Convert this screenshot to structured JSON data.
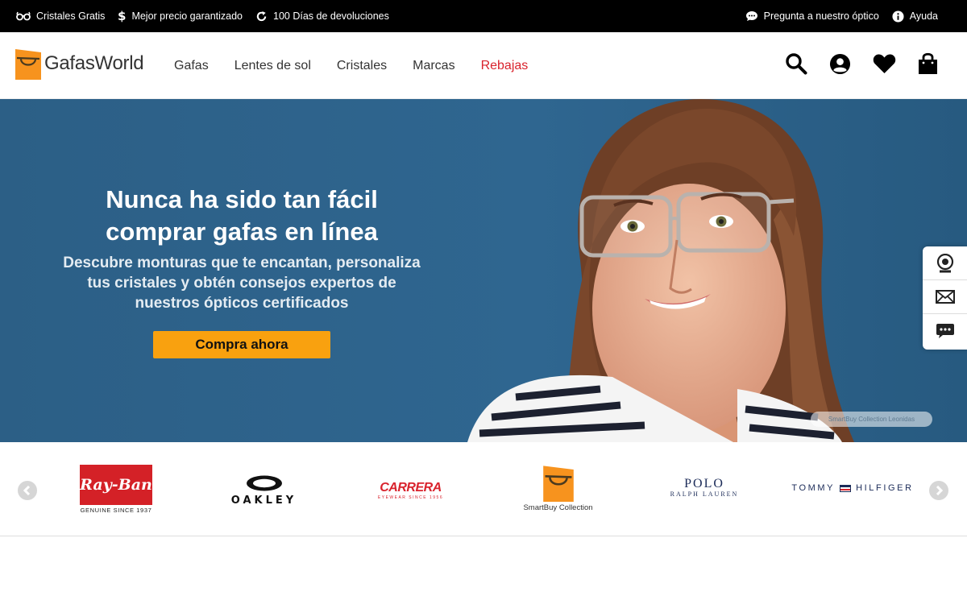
{
  "topbar": {
    "left": [
      {
        "icon": "glasses-icon",
        "label": "Cristales Gratis"
      },
      {
        "icon": "dollar-icon",
        "label": "Mejor precio garantizado"
      },
      {
        "icon": "refresh-icon",
        "label": "100 Días de devoluciones"
      }
    ],
    "right": [
      {
        "icon": "chat-bubble-icon",
        "label": "Pregunta a nuestro óptico"
      },
      {
        "icon": "info-icon",
        "label": "Ayuda"
      }
    ]
  },
  "header": {
    "logo_text": "GafasWorld",
    "nav": [
      "Gafas",
      "Lentes de sol",
      "Cristales",
      "Marcas",
      "Rebajas"
    ],
    "icons": [
      "search-icon",
      "account-icon",
      "heart-icon",
      "shopping-bag-icon"
    ]
  },
  "hero": {
    "title_line1": "Nunca ha sido tan fácil",
    "title_line2": "comprar gafas en línea",
    "subtitle_line1": "Descubre monturas que te encantan, personaliza",
    "subtitle_line2": "tus cristales y obtén consejos expertos de",
    "subtitle_line3": "nuestros ópticos certificados",
    "cta": "Compra ahora",
    "caption": "SmartBuy Collection Leonidas"
  },
  "side_widget": [
    "webcam-icon",
    "mail-icon",
    "chat-icon"
  ],
  "brands": {
    "rayban_name": "Ray-Ban",
    "rayban_tag": "GENUINE SINCE 1937",
    "oakley": "OAKLEY",
    "carrera_name": "CARRERA",
    "carrera_tag": "EYEWEAR SINCE 1956",
    "smartbuy": "SmartBuy Collection",
    "polo_line1": "POLO",
    "polo_line2": "RALPH LAUREN",
    "tommy_left": "TOMMY",
    "tommy_right": "HILFIGER"
  },
  "colors": {
    "accent": "#f9a10f",
    "sale": "#d9232d",
    "hero_bg": "#2f6690"
  }
}
